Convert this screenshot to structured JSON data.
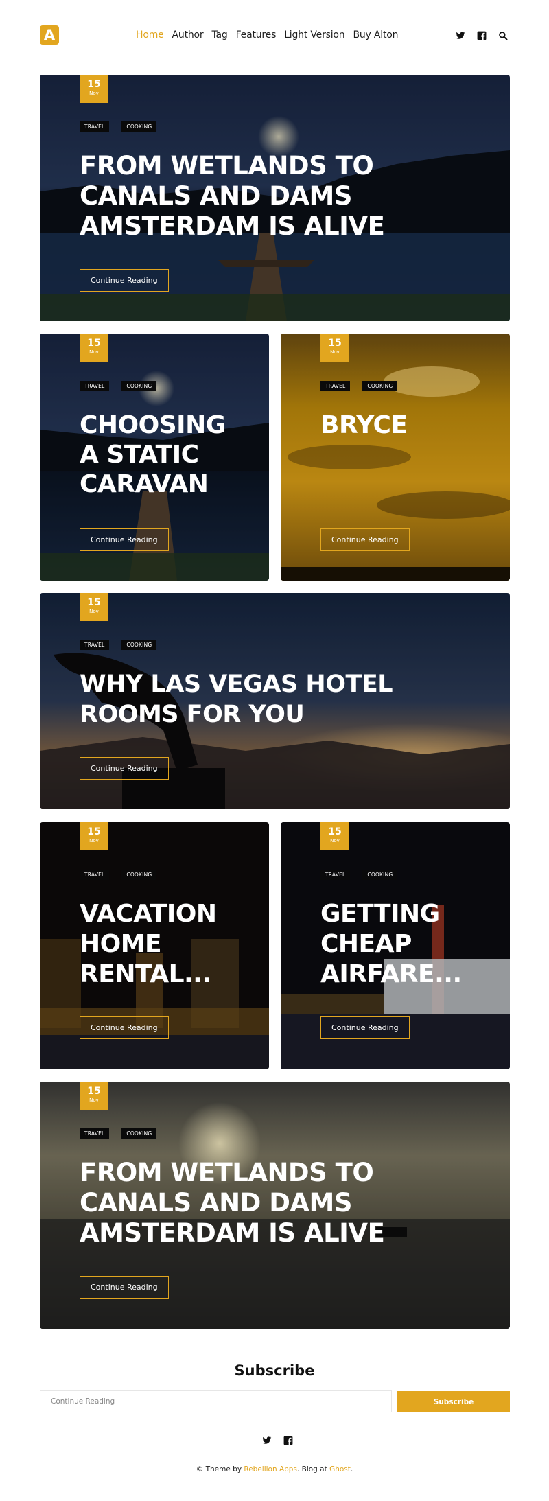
{
  "brand": {
    "logo_letter": "A",
    "accent": "#e2a61f"
  },
  "nav": [
    {
      "label": "Home",
      "active": true
    },
    {
      "label": "Author"
    },
    {
      "label": "Tag"
    },
    {
      "label": "Features"
    },
    {
      "label": "Light Version"
    },
    {
      "label": "Buy Alton"
    }
  ],
  "header_icons": [
    "twitter-icon",
    "facebook-icon",
    "search-icon"
  ],
  "posts": [
    {
      "day": "15",
      "month": "Nov",
      "tags": [
        "TRAVEL",
        "COOKING"
      ],
      "title_lines": [
        "FROM WETLANDS TO",
        "CANALS AND DAMS",
        "AMSTERDAM IS ALIVE"
      ],
      "cta": "Continue Reading",
      "image": "lake-pier-night"
    },
    {
      "day": "15",
      "month": "Nov",
      "tags": [
        "TRAVEL",
        "COOKING"
      ],
      "title_lines": [
        "CHOOSING",
        "A STATIC",
        "CARAVAN"
      ],
      "cta": "Continue Reading",
      "image": "lake-pier-night"
    },
    {
      "day": "15",
      "month": "Nov",
      "tags": [
        "TRAVEL",
        "COOKING"
      ],
      "title_lines": [
        "BRYCE"
      ],
      "cta": "Continue Reading",
      "image": "golden-clouds"
    },
    {
      "day": "15",
      "month": "Nov",
      "tags": [
        "TRAVEL",
        "COOKING"
      ],
      "title_lines": [
        "WHY LAS VEGAS HOTEL",
        "ROOMS FOR YOU"
      ],
      "cta": "Continue Reading",
      "image": "dog-silhouette-dusk"
    },
    {
      "day": "15",
      "month": "Nov",
      "tags": [
        "TRAVEL",
        "COOKING"
      ],
      "title_lines": [
        "VACATION",
        "HOME",
        "RENTAL..."
      ],
      "cta": "Continue Reading",
      "image": "city-night-lights"
    },
    {
      "day": "15",
      "month": "Nov",
      "tags": [
        "TRAVEL",
        "COOKING"
      ],
      "title_lines": [
        "GETTING",
        "CHEAP",
        "AIRFARE..."
      ],
      "cta": "Continue Reading",
      "image": "river-palace-night"
    },
    {
      "day": "15",
      "month": "Nov",
      "tags": [
        "TRAVEL",
        "COOKING"
      ],
      "title_lines": [
        "FROM WETLANDS TO",
        "CANALS AND DAMS",
        "AMSTERDAM IS ALIVE"
      ],
      "cta": "Continue Reading",
      "image": "sunset-sea-boat"
    }
  ],
  "subscribe": {
    "heading": "Subscribe",
    "placeholder": "Continue Reading",
    "button": "Subscribe"
  },
  "footer": {
    "icons": [
      "twitter-icon",
      "facebook-icon"
    ],
    "prefix": "© Theme by ",
    "theme_link": "Rebellion Apps",
    "middle": ". Blog at ",
    "platform_link": "Ghost",
    "suffix": "."
  }
}
